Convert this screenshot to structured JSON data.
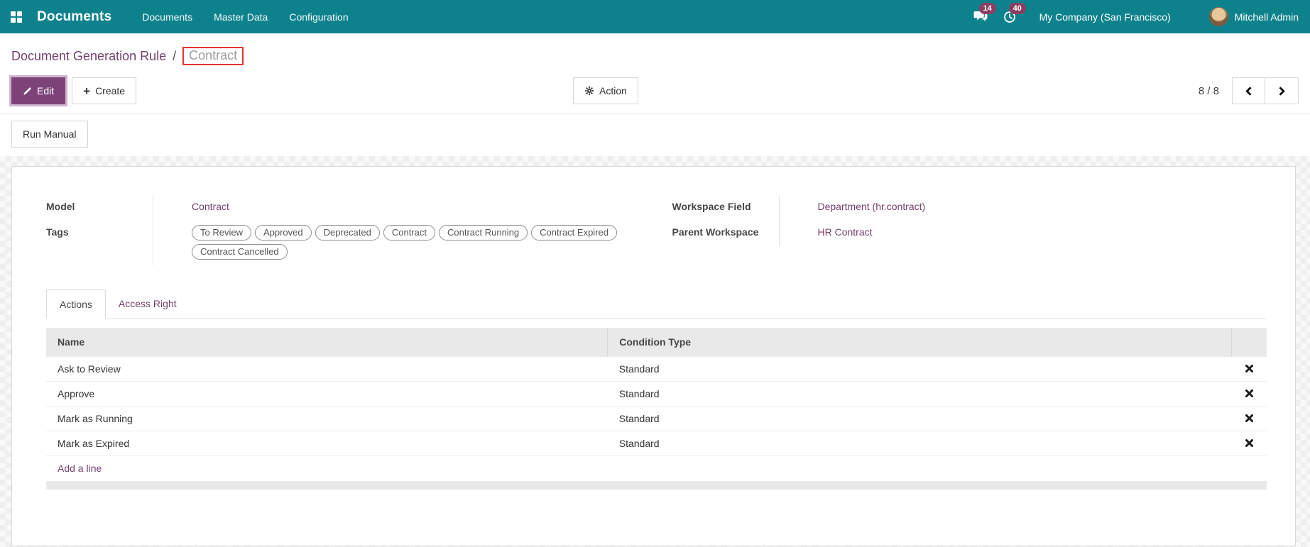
{
  "navbar": {
    "brand": "Documents",
    "menus": [
      {
        "label": "Documents"
      },
      {
        "label": "Master Data"
      },
      {
        "label": "Configuration"
      }
    ],
    "messages_badge": "14",
    "activities_badge": "40",
    "company": "My Company (San Francisco)",
    "user_name": "Mitchell Admin"
  },
  "breadcrumb": {
    "parent": "Document Generation Rule",
    "separator": "/",
    "current": "Contract"
  },
  "control_panel": {
    "edit": "Edit",
    "create": "Create",
    "action": "Action",
    "pager_value": "8 / 8"
  },
  "icons": {
    "plus_char": "+"
  },
  "status_buttons": {
    "run_manual": "Run Manual"
  },
  "form": {
    "left_fields": {
      "model_label": "Model",
      "model_value": "Contract",
      "tags_label": "Tags",
      "tags": [
        "To Review",
        "Approved",
        "Deprecated",
        "Contract",
        "Contract Running",
        "Contract Expired",
        "Contract Cancelled"
      ]
    },
    "right_fields": {
      "workspace_field_label": "Workspace Field",
      "workspace_field_value": "Department (hr.contract)",
      "parent_workspace_label": "Parent Workspace",
      "parent_workspace_value": "HR Contract"
    },
    "tabs": [
      {
        "label": "Actions"
      },
      {
        "label": "Access Right"
      }
    ],
    "actions_table": {
      "columns": [
        "Name",
        "Condition Type"
      ],
      "rows": [
        {
          "name": "Ask to Review",
          "condition_type": "Standard"
        },
        {
          "name": "Approve",
          "condition_type": "Standard"
        },
        {
          "name": "Mark as Running",
          "condition_type": "Standard"
        },
        {
          "name": "Mark as Expired",
          "condition_type": "Standard"
        }
      ],
      "add_line": "Add a line"
    }
  },
  "colors": {
    "navbar_bg": "#0e828c",
    "primary_purple": "#7d4379",
    "link_purple": "#75406f",
    "badge": "#8c3e62",
    "annotation_red": "#e5342e",
    "table_header_bg": "#e9e9e9"
  }
}
